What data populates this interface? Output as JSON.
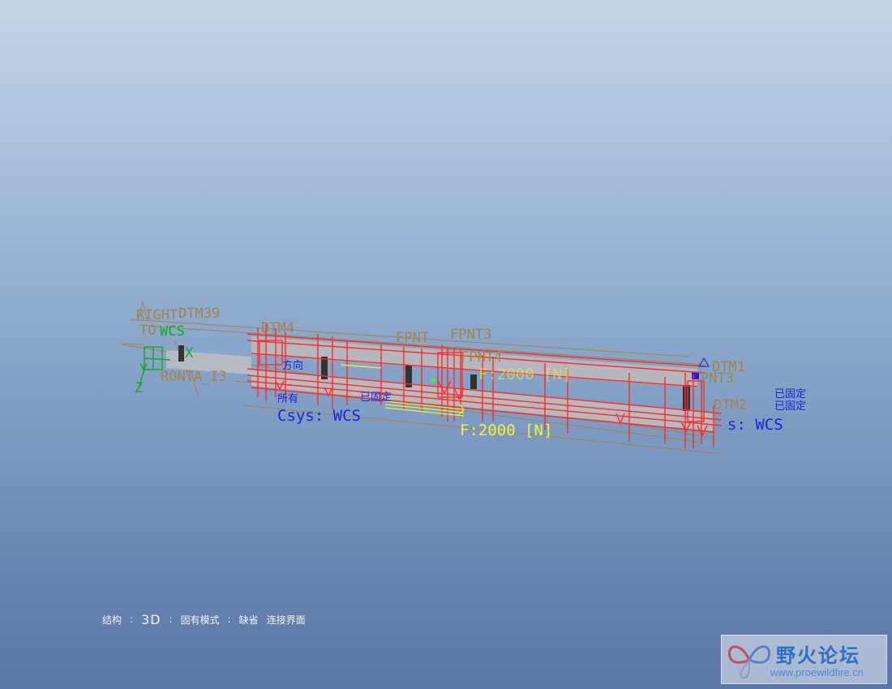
{
  "model_labels": {
    "right": "RIGHT",
    "dtm39": "DTM39",
    "dtm4": "DTM4",
    "dtm1": "DTM1",
    "dtm2": "DTM2",
    "top_tag": "TO",
    "wcs_green": "WCS",
    "front_a": "RONTA_I3",
    "fpnt": "FPNT",
    "fpnt3": "FPNT3",
    "fpnt4": "FPNT4",
    "pnt3": "PNT3",
    "csys_left": "Csys: WCS",
    "csys_right": "s: WCS",
    "force_left": "F:2000 [N]",
    "force_top": "F:2000 [N]",
    "constraint_all": "所有",
    "constraint_fixed": "已固定",
    "constraint_dir": "方向",
    "axis_x": "X",
    "axis_y": "Y",
    "axis_z": "Z"
  },
  "status_bar": {
    "structure": "结构",
    "sep1": ":",
    "mode": "3D",
    "sep2": ":",
    "inherent_mode": "固有模式",
    "sep3": ":",
    "default": "缺省",
    "interface": "连接界面"
  },
  "watermark": {
    "title": "野火论坛",
    "url": "www.proewildfire.cn"
  },
  "colors": {
    "load_red": "#ff2a2a",
    "label_brown": "#a08450",
    "label_blue": "#1a24d8",
    "label_green": "#15a526",
    "label_yellow": "#f2f040",
    "beam_gray": "#b9b9b9"
  }
}
